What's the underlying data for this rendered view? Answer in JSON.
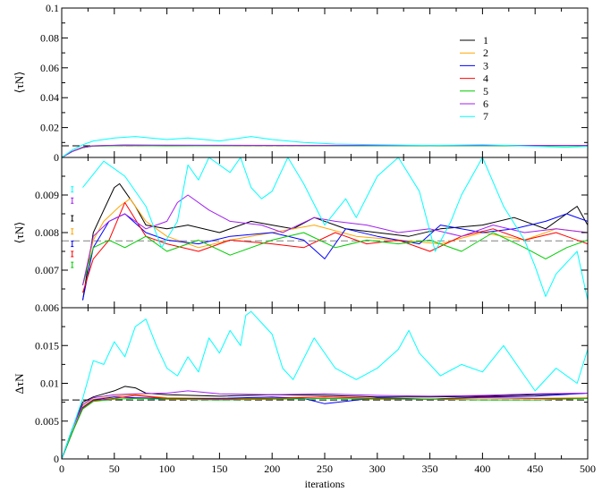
{
  "figure": {
    "xlabel": "iterations",
    "x_ticks": [
      "0",
      "50",
      "100",
      "150",
      "200",
      "250",
      "300",
      "350",
      "400",
      "450",
      "500"
    ],
    "legend": [
      "1",
      "2",
      "3",
      "4",
      "5",
      "6",
      "7"
    ]
  },
  "chart_data": [
    {
      "type": "line",
      "panel": "top",
      "ylabel": "⟨τN⟩",
      "xlim": [
        0,
        500
      ],
      "ylim": [
        0,
        0.1
      ],
      "y_ticks": [
        "0",
        "0.02",
        "0.04",
        "0.06",
        "0.08",
        "0.1"
      ],
      "legend_position": "top-right",
      "reference_line": {
        "y": 0.0078,
        "style": "dashed",
        "color": "#000000"
      },
      "series": [
        {
          "name": "1",
          "color": "#000000",
          "x": [
            0,
            10,
            20,
            30,
            60,
            100,
            200,
            300,
            400,
            500
          ],
          "values": [
            0,
            0.004,
            0.0068,
            0.0078,
            0.0082,
            0.008,
            0.0081,
            0.0079,
            0.008,
            0.0081
          ]
        },
        {
          "name": "2",
          "color": "#ffa500",
          "x": [
            0,
            10,
            20,
            30,
            60,
            100,
            200,
            300,
            400,
            500
          ],
          "values": [
            0,
            0.004,
            0.0067,
            0.0077,
            0.0081,
            0.0079,
            0.008,
            0.0079,
            0.0079,
            0.008
          ]
        },
        {
          "name": "3",
          "color": "#0000ff",
          "x": [
            0,
            10,
            20,
            30,
            60,
            100,
            200,
            300,
            400,
            500
          ],
          "values": [
            0,
            0.004,
            0.0066,
            0.0077,
            0.008,
            0.0079,
            0.008,
            0.0078,
            0.0079,
            0.008
          ]
        },
        {
          "name": "4",
          "color": "#ff0000",
          "x": [
            0,
            10,
            20,
            30,
            60,
            100,
            200,
            300,
            400,
            500
          ],
          "values": [
            0,
            0.004,
            0.0066,
            0.0076,
            0.008,
            0.0078,
            0.0079,
            0.0078,
            0.0078,
            0.0078
          ]
        },
        {
          "name": "5",
          "color": "#00cc00",
          "x": [
            0,
            10,
            20,
            30,
            60,
            100,
            200,
            300,
            400,
            500
          ],
          "values": [
            0,
            0.004,
            0.0066,
            0.0076,
            0.0079,
            0.0077,
            0.0079,
            0.0078,
            0.0078,
            0.0078
          ]
        },
        {
          "name": "6",
          "color": "#a020f0",
          "x": [
            0,
            10,
            20,
            30,
            60,
            100,
            200,
            300,
            400,
            500
          ],
          "values": [
            0,
            0.004,
            0.0067,
            0.0078,
            0.0083,
            0.0082,
            0.0081,
            0.008,
            0.008,
            0.0081
          ]
        },
        {
          "name": "7",
          "color": "#00ffff",
          "x": [
            0,
            10,
            20,
            30,
            50,
            70,
            100,
            120,
            150,
            180,
            200,
            230,
            260,
            300,
            350,
            400,
            450,
            480,
            500
          ],
          "values": [
            0,
            0.005,
            0.0085,
            0.011,
            0.013,
            0.014,
            0.012,
            0.013,
            0.011,
            0.014,
            0.012,
            0.01,
            0.009,
            0.0085,
            0.008,
            0.0085,
            0.0075,
            0.0068,
            0.0075
          ]
        }
      ]
    },
    {
      "type": "line",
      "panel": "middle",
      "ylabel": "⟨τN⟩",
      "xlim": [
        0,
        500
      ],
      "ylim": [
        0.006,
        0.01
      ],
      "y_ticks": [
        "0.006",
        "0.007",
        "0.008",
        "0.009"
      ],
      "reference_line": {
        "y": 0.00778,
        "style": "dashed",
        "color": "#808080"
      },
      "series": [
        {
          "name": "1",
          "color": "#000000",
          "x": [
            20,
            30,
            40,
            50,
            55,
            60,
            70,
            80,
            100,
            120,
            150,
            180,
            200,
            220,
            240,
            270,
            300,
            330,
            360,
            400,
            430,
            460,
            480,
            490,
            500
          ],
          "values": [
            0.0062,
            0.008,
            0.0086,
            0.0092,
            0.0093,
            0.0091,
            0.0087,
            0.0082,
            0.0081,
            0.0082,
            0.008,
            0.0083,
            0.0082,
            0.0081,
            0.0084,
            0.0081,
            0.008,
            0.0079,
            0.0081,
            0.0082,
            0.0084,
            0.0081,
            0.0085,
            0.0087,
            0.0082
          ]
        },
        {
          "name": "2",
          "color": "#ffa500",
          "x": [
            20,
            30,
            40,
            55,
            65,
            80,
            100,
            130,
            160,
            200,
            240,
            280,
            320,
            360,
            400,
            440,
            470,
            500
          ],
          "values": [
            0.0066,
            0.0078,
            0.0083,
            0.0087,
            0.0089,
            0.0083,
            0.0079,
            0.0076,
            0.0078,
            0.008,
            0.0082,
            0.0079,
            0.0078,
            0.0077,
            0.008,
            0.0078,
            0.0081,
            0.008
          ]
        },
        {
          "name": "3",
          "color": "#0000ff",
          "x": [
            20,
            30,
            45,
            60,
            80,
            100,
            130,
            160,
            200,
            230,
            250,
            270,
            300,
            340,
            360,
            400,
            430,
            460,
            480,
            500
          ],
          "values": [
            0.0062,
            0.0076,
            0.0083,
            0.0085,
            0.008,
            0.0078,
            0.0077,
            0.0079,
            0.008,
            0.0078,
            0.0073,
            0.0081,
            0.0079,
            0.0077,
            0.0082,
            0.008,
            0.0081,
            0.0083,
            0.0085,
            0.0083
          ]
        },
        {
          "name": "4",
          "color": "#ff0000",
          "x": [
            20,
            30,
            45,
            60,
            80,
            100,
            130,
            160,
            200,
            230,
            260,
            290,
            320,
            350,
            380,
            410,
            440,
            470,
            500
          ],
          "values": [
            0.0064,
            0.0073,
            0.0078,
            0.0088,
            0.0079,
            0.0077,
            0.0075,
            0.0078,
            0.0077,
            0.0076,
            0.008,
            0.0077,
            0.0078,
            0.0075,
            0.0079,
            0.0081,
            0.0078,
            0.008,
            0.0077
          ]
        },
        {
          "name": "5",
          "color": "#00cc00",
          "x": [
            20,
            30,
            45,
            60,
            80,
            100,
            130,
            160,
            200,
            230,
            260,
            290,
            320,
            350,
            380,
            410,
            440,
            460,
            480,
            500
          ],
          "values": [
            0.0066,
            0.0076,
            0.0078,
            0.0076,
            0.0079,
            0.0075,
            0.0078,
            0.0074,
            0.0078,
            0.008,
            0.0076,
            0.0078,
            0.0077,
            0.0078,
            0.0075,
            0.008,
            0.0076,
            0.0073,
            0.0076,
            0.0078
          ]
        },
        {
          "name": "6",
          "color": "#a020f0",
          "x": [
            20,
            30,
            45,
            60,
            80,
            100,
            110,
            120,
            140,
            160,
            190,
            210,
            240,
            260,
            290,
            320,
            350,
            380,
            410,
            440,
            470,
            500
          ],
          "values": [
            0.0066,
            0.0079,
            0.0083,
            0.0085,
            0.0081,
            0.0083,
            0.0088,
            0.009,
            0.0086,
            0.0083,
            0.0082,
            0.008,
            0.0084,
            0.0083,
            0.0082,
            0.008,
            0.0081,
            0.0079,
            0.0082,
            0.008,
            0.0081,
            0.008
          ]
        },
        {
          "name": "7",
          "color": "#00ffff",
          "x": [
            20,
            40,
            60,
            80,
            95,
            110,
            120,
            130,
            140,
            160,
            170,
            180,
            190,
            200,
            215,
            230,
            250,
            270,
            280,
            300,
            320,
            340,
            355,
            370,
            380,
            400,
            420,
            440,
            450,
            460,
            470,
            490,
            500
          ],
          "values": [
            0.0092,
            0.0099,
            0.0095,
            0.0087,
            0.0076,
            0.0083,
            0.0098,
            0.0094,
            0.01,
            0.0096,
            0.01,
            0.0092,
            0.0089,
            0.0091,
            0.01,
            0.0093,
            0.0082,
            0.0089,
            0.0084,
            0.0095,
            0.01,
            0.0091,
            0.0075,
            0.0083,
            0.009,
            0.01,
            0.0087,
            0.0078,
            0.0071,
            0.0063,
            0.0069,
            0.0075,
            0.0062
          ]
        }
      ],
      "annotations": [
        {
          "kind": "error-bar",
          "series": "7",
          "x": 10,
          "y": 0.00915
        },
        {
          "kind": "error-bar",
          "series": "6",
          "x": 10,
          "y": 0.00885
        },
        {
          "kind": "error-bar",
          "series": "1",
          "x": 10,
          "y": 0.00838
        },
        {
          "kind": "error-bar",
          "series": "2",
          "x": 10,
          "y": 0.00803
        },
        {
          "kind": "error-bar",
          "series": "3",
          "x": 10,
          "y": 0.0077
        },
        {
          "kind": "error-bar",
          "series": "4",
          "x": 10,
          "y": 0.00743
        },
        {
          "kind": "error-bar",
          "series": "5",
          "x": 10,
          "y": 0.00714
        }
      ]
    },
    {
      "type": "line",
      "panel": "bottom",
      "ylabel": "ΔτN",
      "xlabel": "iterations",
      "xlim": [
        0,
        500
      ],
      "ylim": [
        0,
        0.02
      ],
      "y_ticks": [
        "0",
        "0.005",
        "0.01",
        "0.015"
      ],
      "reference_line": {
        "y": 0.0078,
        "style": "dashed",
        "color": "#000000"
      },
      "series": [
        {
          "name": "1",
          "color": "#000000",
          "x": [
            0,
            10,
            20,
            30,
            40,
            50,
            60,
            70,
            80,
            100,
            150,
            200,
            250,
            300,
            350,
            400,
            450,
            500
          ],
          "values": [
            0,
            0.004,
            0.0075,
            0.0082,
            0.0086,
            0.009,
            0.0096,
            0.0094,
            0.0087,
            0.0085,
            0.0083,
            0.0085,
            0.0084,
            0.0082,
            0.0082,
            0.0083,
            0.0085,
            0.0087
          ]
        },
        {
          "name": "2",
          "color": "#ffa500",
          "x": [
            0,
            10,
            20,
            30,
            50,
            70,
            100,
            150,
            200,
            250,
            300,
            350,
            400,
            450,
            500
          ],
          "values": [
            0,
            0.0035,
            0.007,
            0.0079,
            0.0083,
            0.0085,
            0.0081,
            0.008,
            0.0081,
            0.0082,
            0.008,
            0.0079,
            0.0081,
            0.008,
            0.0081
          ]
        },
        {
          "name": "3",
          "color": "#0000ff",
          "x": [
            0,
            10,
            20,
            30,
            50,
            70,
            100,
            150,
            200,
            230,
            250,
            300,
            350,
            400,
            450,
            500
          ],
          "values": [
            0,
            0.0035,
            0.0068,
            0.0078,
            0.0082,
            0.0081,
            0.008,
            0.008,
            0.0082,
            0.008,
            0.0073,
            0.0081,
            0.0079,
            0.0082,
            0.0083,
            0.0087
          ]
        },
        {
          "name": "4",
          "color": "#ff0000",
          "x": [
            0,
            10,
            20,
            30,
            50,
            70,
            100,
            150,
            200,
            250,
            300,
            350,
            400,
            450,
            500
          ],
          "values": [
            0,
            0.0035,
            0.0067,
            0.0077,
            0.008,
            0.0084,
            0.008,
            0.0079,
            0.008,
            0.0082,
            0.008,
            0.0079,
            0.0081,
            0.008,
            0.008
          ]
        },
        {
          "name": "5",
          "color": "#00cc00",
          "x": [
            0,
            10,
            20,
            30,
            50,
            70,
            100,
            150,
            200,
            250,
            300,
            350,
            400,
            450,
            500
          ],
          "values": [
            0,
            0.0035,
            0.0066,
            0.0076,
            0.0079,
            0.008,
            0.0079,
            0.0078,
            0.0079,
            0.008,
            0.0079,
            0.0079,
            0.0078,
            0.0078,
            0.008
          ]
        },
        {
          "name": "6",
          "color": "#a020f0",
          "x": [
            0,
            10,
            20,
            30,
            50,
            70,
            100,
            120,
            150,
            200,
            250,
            300,
            350,
            400,
            450,
            500
          ],
          "values": [
            0,
            0.004,
            0.0072,
            0.0081,
            0.0085,
            0.0086,
            0.0087,
            0.009,
            0.0086,
            0.0085,
            0.0086,
            0.0084,
            0.0083,
            0.0084,
            0.0086,
            0.0087
          ]
        },
        {
          "name": "7",
          "color": "#00ffff",
          "x": [
            0,
            10,
            20,
            30,
            40,
            50,
            60,
            70,
            80,
            90,
            100,
            110,
            120,
            130,
            140,
            150,
            160,
            170,
            175,
            180,
            190,
            200,
            210,
            220,
            240,
            260,
            280,
            300,
            320,
            330,
            340,
            360,
            380,
            400,
            420,
            440,
            450,
            470,
            490,
            500
          ],
          "values": [
            0,
            0.004,
            0.008,
            0.013,
            0.0125,
            0.0155,
            0.0135,
            0.0175,
            0.0185,
            0.015,
            0.012,
            0.011,
            0.0135,
            0.0115,
            0.016,
            0.014,
            0.017,
            0.015,
            0.019,
            0.0195,
            0.018,
            0.0165,
            0.012,
            0.0105,
            0.016,
            0.012,
            0.0105,
            0.012,
            0.0145,
            0.017,
            0.014,
            0.011,
            0.0125,
            0.0115,
            0.015,
            0.011,
            0.009,
            0.012,
            0.01,
            0.0145
          ]
        }
      ]
    }
  ]
}
